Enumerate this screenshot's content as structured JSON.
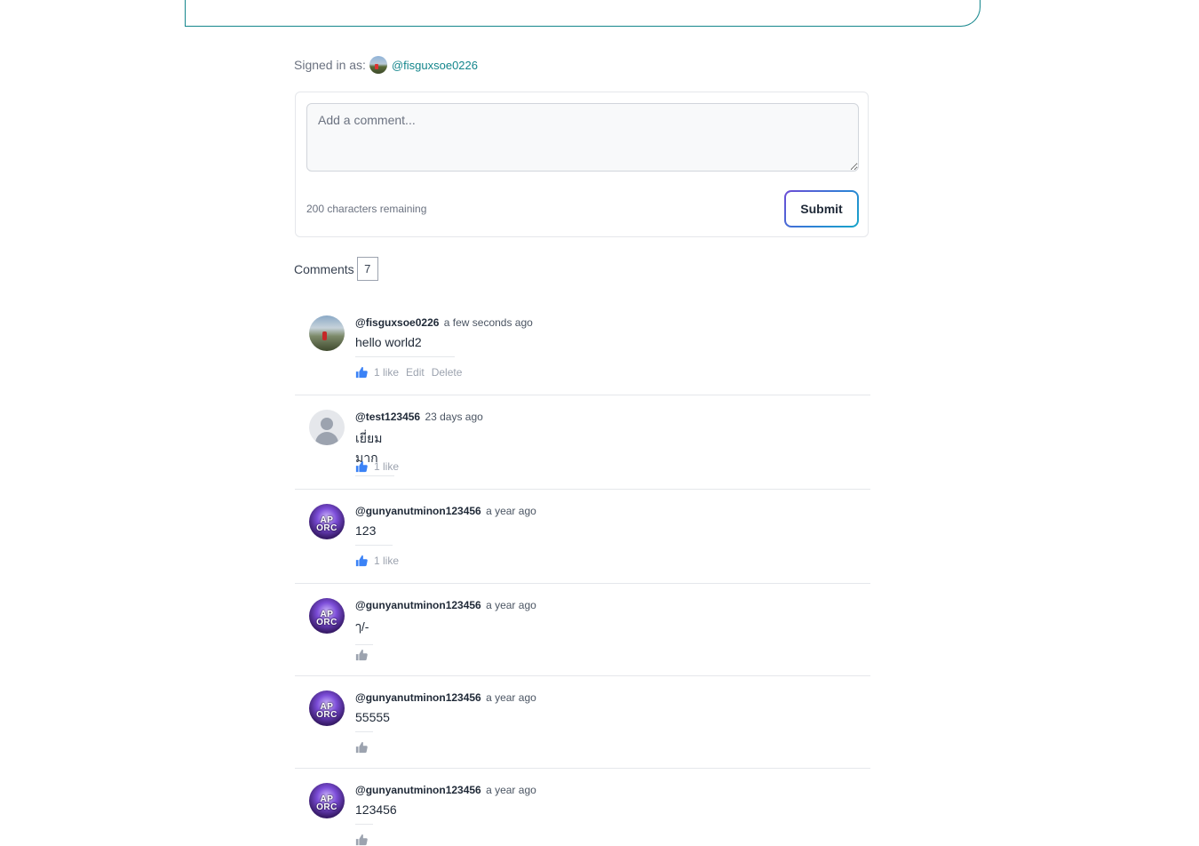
{
  "signed_in": {
    "label": "Signed in as:",
    "handle": "@fisguxsoe0226"
  },
  "comment_form": {
    "placeholder": "Add a comment...",
    "chars_remaining": "200 characters remaining",
    "submit_label": "Submit"
  },
  "comments_header": {
    "label": "Comments",
    "count": "7"
  },
  "colors": {
    "accent": "#14868c",
    "like_active": "#3b82f6",
    "like_inactive": "#9ca3af"
  },
  "comments": [
    {
      "user": "@fisguxsoe0226",
      "time": "a few seconds ago",
      "text": "hello world2",
      "likes": "1 like",
      "edit": "Edit",
      "delete": "Delete"
    },
    {
      "user": "@test123456",
      "time": "23 days ago",
      "text": "เยี่ยมมาก",
      "likes": "1 like"
    },
    {
      "user": "@gunyanutminon123456",
      "time": "a year ago",
      "text": "123",
      "likes": "1 like"
    },
    {
      "user": "@gunyanutminon123456",
      "time": "a year ago",
      "text": "ๅ/-"
    },
    {
      "user": "@gunyanutminon123456",
      "time": "a year ago",
      "text": "55555"
    },
    {
      "user": "@gunyanutminon123456",
      "time": "a year ago",
      "text": "123456"
    }
  ]
}
